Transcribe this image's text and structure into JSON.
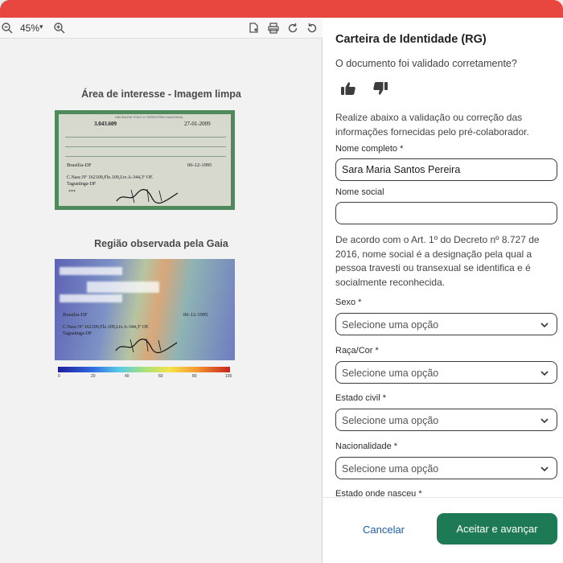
{
  "viewer": {
    "zoom_value": "45%",
    "zoom_caret": "▾",
    "section_clean_title": "Área de interesse - Imagem limpa",
    "section_heat_title": "Região observada pela Gaia",
    "document": {
      "rg_number": "3.043.609",
      "issue_date": "27-01-2009",
      "naturalidade": "Brasilia-DF",
      "birth_date": "06-12-1995",
      "doc_origem_line1": "C.Nasc.Nº 162109,Flo.109,Liv.A-344,3º OF.",
      "doc_origem_line2": "Taguatinga-DF",
      "stars": "***",
      "validity_banner": "VÁLIDA EM TODO O TERRITÓRIO NACIONAL"
    },
    "colorbar_ticks": [
      "0",
      "20",
      "40",
      "60",
      "80",
      "100"
    ]
  },
  "panel": {
    "title": "Carteira de Identidade (RG)",
    "question": "O documento foi validado corretamente?",
    "instructions": "Realize abaixo a validação ou correção das informações fornecidas pelo pré-colaborador.",
    "full_name_label": "Nome completo *",
    "full_name_value": "Sara Maria Santos Pereira",
    "social_name_label": "Nome social",
    "social_name_value": "",
    "social_name_note": "De acordo com o Art. 1º do Decreto nº 8.727 de 2016, nome social é a designação pela qual a pessoa travesti ou transexual se identifica e é socialmente reconhecida.",
    "sexo_label": "Sexo *",
    "raca_label": "Raça/Cor *",
    "estado_civil_label": "Estado civil *",
    "nacionalidade_label": "Nacionalidade *",
    "estado_nasceu_label": "Estado onde nasceu *",
    "select_placeholder": "Selecione uma opção"
  },
  "footer": {
    "cancel_label": "Cancelar",
    "accept_label": "Aceitar e avançar"
  },
  "colors": {
    "topbar": "#e8473f",
    "accent_green": "#1e7a55",
    "cancel_blue": "#1f5fa8",
    "card_border_green": "#4e8a5b"
  }
}
